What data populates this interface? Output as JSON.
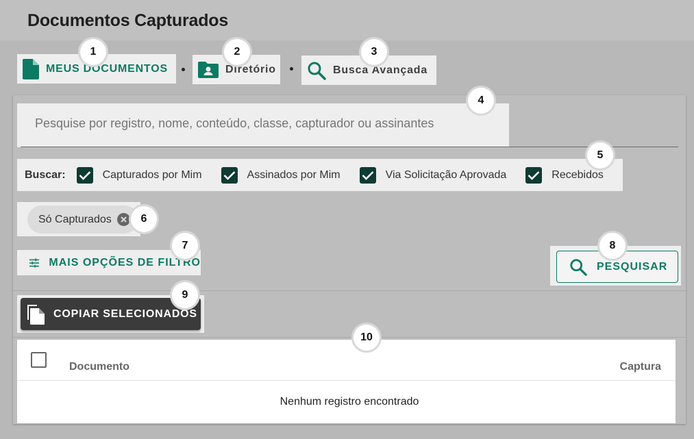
{
  "page": {
    "title": "Documentos Capturados"
  },
  "nav": {
    "tabs": [
      {
        "label": "MEUS DOCUMENTOS",
        "icon": "document-icon",
        "active": true
      },
      {
        "label": "Diretório",
        "icon": "folder-user-icon",
        "active": false
      },
      {
        "label": "Busca Avançada",
        "icon": "search-icon",
        "active": false
      }
    ]
  },
  "search": {
    "placeholder": "Pesquise por registro, nome, conteúdo, classe, capturador ou assinantes",
    "value": ""
  },
  "filters": {
    "label": "Buscar:",
    "options": [
      {
        "label": "Capturados por Mim",
        "checked": true
      },
      {
        "label": "Assinados por Mim",
        "checked": true
      },
      {
        "label": "Via Solicitação Aprovada",
        "checked": true
      },
      {
        "label": "Recebidos",
        "checked": true
      }
    ]
  },
  "chip": {
    "label": "Só Capturados"
  },
  "more_filters": {
    "label": "MAIS OPÇÕES DE FILTRO"
  },
  "search_button": {
    "label": "PESQUISAR"
  },
  "copy_button": {
    "label": "COPIAR SELECIONADOS"
  },
  "table": {
    "columns": [
      "Documento",
      "Captura"
    ],
    "empty_message": "Nenhum registro encontrado"
  },
  "badges": [
    "1",
    "2",
    "3",
    "4",
    "5",
    "6",
    "7",
    "8",
    "9",
    "10"
  ],
  "colors": {
    "accent": "#0d7a63",
    "checkbox": "#0e3b32",
    "copy_button_bg": "#3b3b3b"
  }
}
